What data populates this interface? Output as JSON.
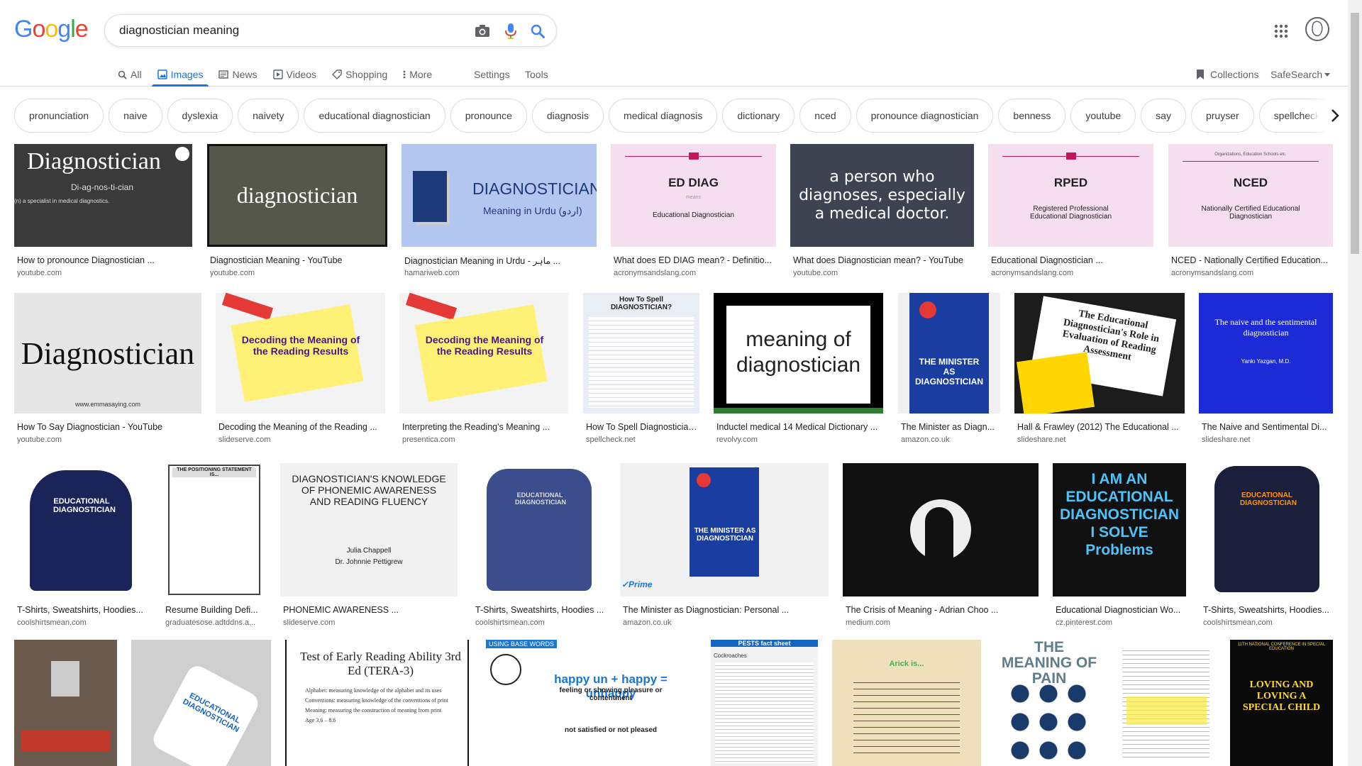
{
  "logo": {
    "letters": [
      "G",
      "o",
      "o",
      "g",
      "l",
      "e"
    ],
    "colors": [
      "#4285f4",
      "#ea4335",
      "#fbbc05",
      "#4285f4",
      "#34a853",
      "#ea4335"
    ]
  },
  "search": {
    "query": "diagnostician meaning",
    "icons": [
      "camera-icon",
      "mic-icon",
      "search-icon"
    ]
  },
  "tabs": [
    {
      "label": "All",
      "icon": "search-icon",
      "active": false
    },
    {
      "label": "Images",
      "icon": "image-icon",
      "active": true
    },
    {
      "label": "News",
      "icon": "news-icon",
      "active": false
    },
    {
      "label": "Videos",
      "icon": "video-icon",
      "active": false
    },
    {
      "label": "Shopping",
      "icon": "tag-icon",
      "active": false
    },
    {
      "label": "More",
      "icon": "more-vert-icon",
      "active": false
    }
  ],
  "tools": {
    "settings": "Settings",
    "tools": "Tools",
    "collections": "Collections",
    "safesearch": "SafeSearch"
  },
  "chips": [
    "pronunciation",
    "naive",
    "dyslexia",
    "naivety",
    "educational diagnostician",
    "pronounce",
    "diagnosis",
    "medical diagnosis",
    "dictionary",
    "nced",
    "pronounce diagnostician",
    "benness",
    "youtube",
    "say",
    "pruyser",
    "spellcheck"
  ],
  "results": [
    {
      "title": "How to pronounce Diagnostician ...",
      "source": "youtube.com",
      "text": "Diagnostician"
    },
    {
      "title": "Diagnostician Meaning - YouTube",
      "source": "youtube.com",
      "text": "diagnostician"
    },
    {
      "title": "Diagnostician Meaning in Urdu - ماہر ...",
      "source": "hamariweb.com",
      "text": "DIAGNOSTICIAN"
    },
    {
      "title": "What does ED DIAG mean? - Definitio...",
      "source": "acronymsandslang.com",
      "text": "ED DIAG"
    },
    {
      "title": "What does Diagnostician mean? - YouTube",
      "source": "youtube.com",
      "text": "a person who diagnoses, especially a medical doctor."
    },
    {
      "title": "Educational Diagnostician ...",
      "source": "acronymsandslang.com",
      "text": "RPED"
    },
    {
      "title": "NCED - Nationally Certified Education...",
      "source": "acronymsandslang.com",
      "text": "NCED"
    },
    {
      "title": "How To Say Diagnostician - YouTube",
      "source": "youtube.com",
      "text": "Diagnostician"
    },
    {
      "title": "Decoding the Meaning of the Reading ...",
      "source": "slideserve.com",
      "text": "Decoding the Meaning of the Reading Results"
    },
    {
      "title": "Interpreting the Reading's Meaning ...",
      "source": "presentica.com",
      "text": "Decoding the Meaning of the Reading Results"
    },
    {
      "title": "How To Spell Diagnostician...",
      "source": "spellcheck.net",
      "text": "How To Spell DIAGNOSTICIAN?"
    },
    {
      "title": "Inductel medical 14 Medical Dictionary ...",
      "source": "revolvy.com",
      "text": "meaning of diagnostician"
    },
    {
      "title": "The Minister as Diagn...",
      "source": "amazon.co.uk",
      "text": "THE MINISTER AS DIAGNOSTICIAN"
    },
    {
      "title": "Hall & Frawley (2012) The Educational ...",
      "source": "slideshare.net",
      "text": "The Educational Diagnostician's Role in Evaluation of Reading Assessment"
    },
    {
      "title": "The Naive and Sentimental Di...",
      "source": "slideshare.net",
      "text": "The naive and the sentimental diagnostician"
    },
    {
      "title": "T-Shirts, Sweatshirts, Hoodies...",
      "source": "coolshirtsmean.com",
      "text": "EDUCATIONAL DIAGNOSTICIAN"
    },
    {
      "title": "Resume Building Defi...",
      "source": "graduatesose.adtddns.a...",
      "text": "THE POSITIONING STATEMENT IS..."
    },
    {
      "title": "PHONEMIC AWARENESS ...",
      "source": "slideserve.com",
      "text": "DIAGNOSTICIAN'S KNOWLEDGE OF PHONEMIC AWARENESS AND READING FLUENCY"
    },
    {
      "title": "T-Shirts, Sweatshirts, Hoodies ...",
      "source": "coolshirtsmean.com",
      "text": "EDUCATIONAL DIAGNOSTICIAN"
    },
    {
      "title": "The Minister as Diagnostician: Personal ...",
      "source": "amazon.co.uk",
      "text": "THE MINISTER AS DIAGNOSTICIAN"
    },
    {
      "title": "The Crisis of Meaning - Adrian Choo ...",
      "source": "medium.com",
      "text": ""
    },
    {
      "title": "Educational Diagnostician Wo...",
      "source": "cz.pinterest.com",
      "text": "I AM AN EDUCATIONAL DIAGNOSTICIAN I SOLVE Problems"
    },
    {
      "title": "T-Shirts, Sweatshirts, Hoodies...",
      "source": "coolshirtsmean.com",
      "text": "EDUCATIONAL DIAGNOSTICIAN"
    },
    {
      "title": "",
      "source": "",
      "text": ""
    },
    {
      "title": "",
      "source": "",
      "text": "EDUCATIONAL DIAGNOSTICIAN"
    },
    {
      "title": "",
      "source": "",
      "text": "Test of Early Reading Ability 3rd Ed (TERA-3)"
    },
    {
      "title": "",
      "source": "",
      "text": "happy un + happy = unhappy"
    },
    {
      "title": "",
      "source": "",
      "text": "PESTS fact sheet"
    },
    {
      "title": "",
      "source": "",
      "text": "Arick is..."
    },
    {
      "title": "",
      "source": "",
      "text": "THE MEANING OF PAIN"
    },
    {
      "title": "",
      "source": "",
      "text": ""
    },
    {
      "title": "",
      "source": "",
      "text": "LOVING AND LOVING A SPECIAL CHILD"
    }
  ],
  "extra_text": {
    "ed_diag_means": "means",
    "ed_diag_full": "Educational Diagnostician",
    "rped_full": "Registered Professional Educational Diagnostician",
    "nced_top": "Organizations, Education Schools etc.",
    "nced_full": "Nationally Certified Educational Diagnostician",
    "urdu_sub": "Meaning in Urdu (اردو)",
    "pron": "Di-ag-nos-ti-cian",
    "pron_def": "(n) a specialist in medical diagnostics.",
    "emma": "www.emmasaying.com",
    "phonemic_author1": "Julia Chappell",
    "phonemic_author2": "Dr. Johnnie Pettigrew",
    "naive_author": "Yankı Yazgan, M.D.",
    "prime": "✓Prime",
    "tera_items": [
      "Alphabet: measuring knowledge of the alphabet and its uses",
      "Conventions: measuring knowledge of the conventions of print",
      "Meaning: measuring the construction of meaning from print",
      "Age 3.6 – 8.6"
    ],
    "using_base": "USING BASE WORDS",
    "happy_def": "feeling or showing pleasure or contentment",
    "unhappy_def": "not satisfied or not pleased",
    "cockroaches": "Cockroaches",
    "conference": "11TH NATIONAL CONFERENCE IN SPECIAL EDUCATION"
  }
}
